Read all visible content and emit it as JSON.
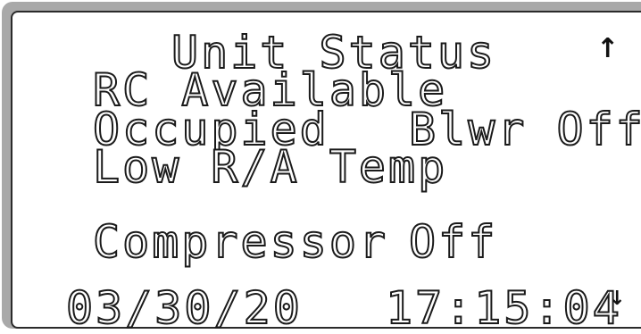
{
  "display": {
    "title": "Unit Status",
    "line1": "RC Available",
    "line2_left": "Occupied",
    "line2_right": "Blwr Off",
    "line3": "Low R/A Temp",
    "line5_left": "Compressor",
    "line5_right": "Off",
    "date": "03/30/20",
    "time": "17:15:04"
  },
  "icons": {
    "scroll_up": "↑",
    "scroll_down": "↓"
  }
}
